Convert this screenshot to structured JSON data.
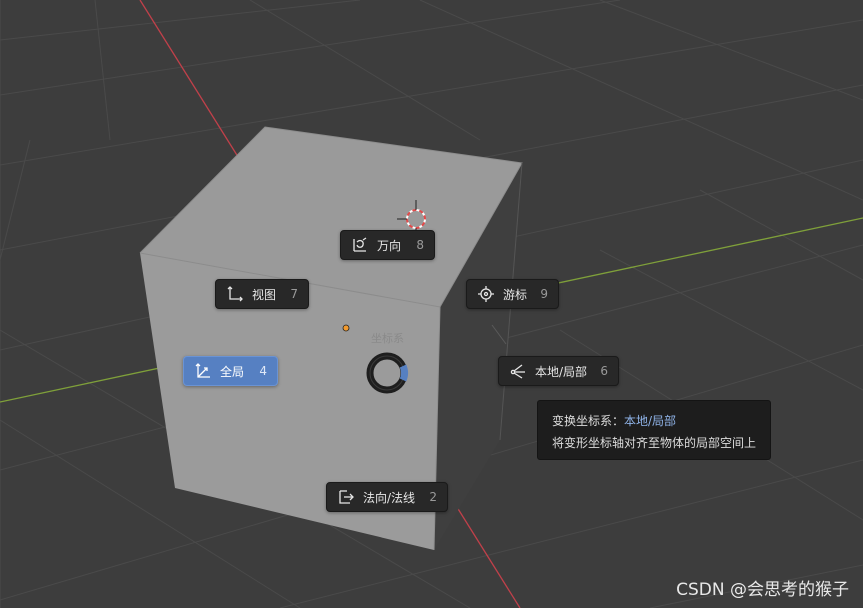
{
  "pie_menu": {
    "title": "坐标系",
    "items": {
      "gimbal": {
        "label": "万向",
        "key": "8",
        "icon": "gimbal-icon"
      },
      "view": {
        "label": "视图",
        "key": "7",
        "icon": "view-axes-icon"
      },
      "cursor": {
        "label": "游标",
        "key": "9",
        "icon": "cursor-icon"
      },
      "global": {
        "label": "全局",
        "key": "4",
        "icon": "global-axes-icon",
        "active": true
      },
      "local": {
        "label": "本地/局部",
        "key": "6",
        "icon": "local-axes-icon"
      },
      "normal": {
        "label": "法向/法线",
        "key": "2",
        "icon": "normal-icon"
      }
    }
  },
  "tooltip": {
    "title": "变换坐标系：",
    "value": "本地/局部",
    "description": "将变形坐标轴对齐至物体的局部空间上"
  },
  "watermark": "CSDN @会思考的猴子",
  "colors": {
    "background": "#3d3d3d",
    "active_item": "#5680c2",
    "x_axis": "#c0404a",
    "y_axis": "#7fa03a"
  }
}
